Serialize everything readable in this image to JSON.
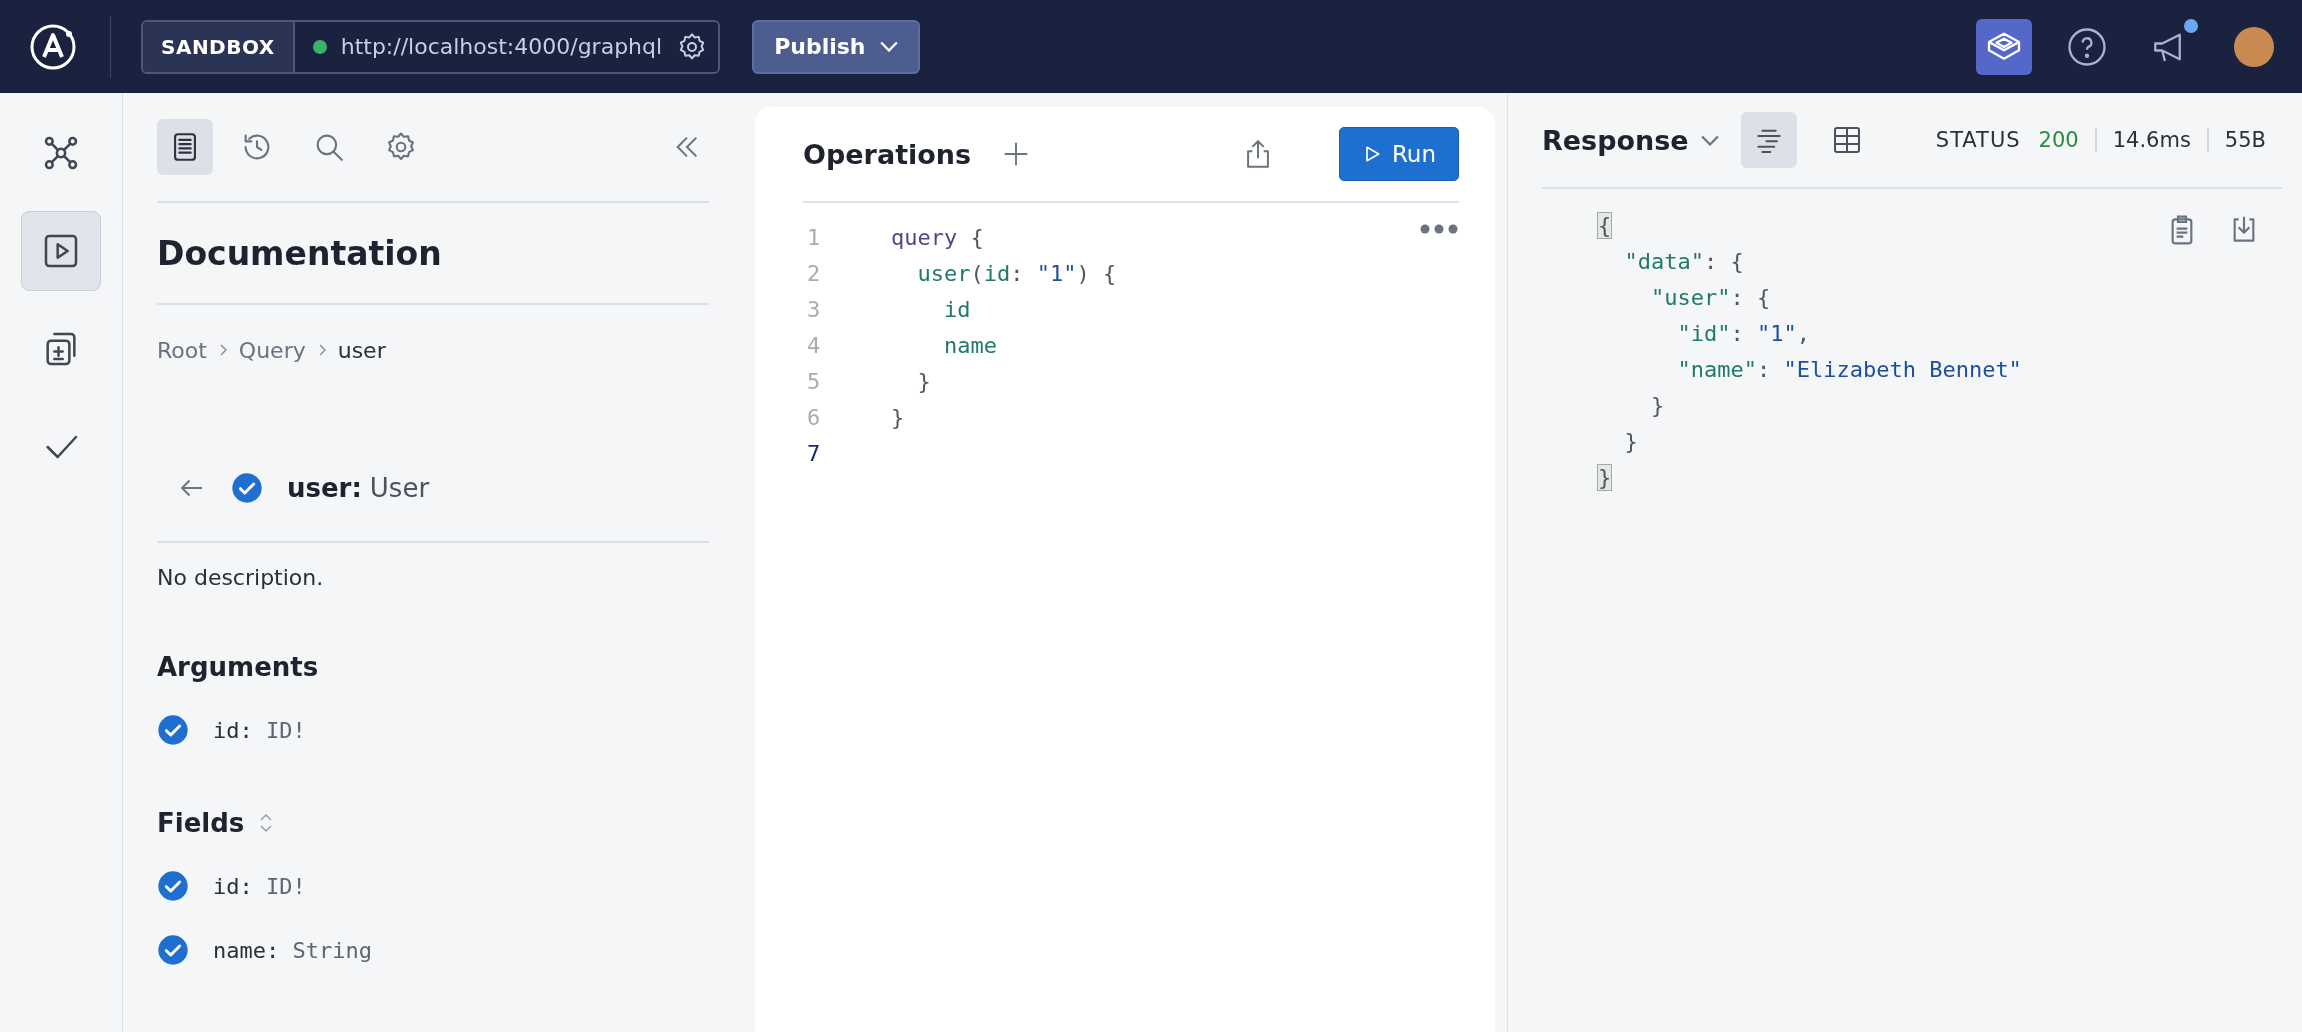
{
  "header": {
    "mode_label": "SANDBOX",
    "endpoint": "http://localhost:4000/graphql",
    "endpoint_connected": true,
    "publish_label": "Publish",
    "notification_unread": true
  },
  "rail": [
    {
      "selected": false
    },
    {
      "selected": true
    },
    {
      "selected": false
    },
    {
      "selected": false
    }
  ],
  "docs": {
    "tools": [
      {
        "selected": true
      },
      {
        "selected": false
      },
      {
        "selected": false
      },
      {
        "selected": false
      }
    ],
    "title": "Documentation",
    "breadcrumb": [
      {
        "label": "Root",
        "current": false
      },
      {
        "label": "Query",
        "current": false
      },
      {
        "label": "user",
        "current": true
      }
    ],
    "field": {
      "name": "user:",
      "type": "User",
      "included": true
    },
    "description": "No description.",
    "sections": [
      {
        "title": "Arguments",
        "sortable": false,
        "items": [
          {
            "name": "id:",
            "type": "ID!",
            "included": true
          }
        ]
      },
      {
        "title": "Fields",
        "sortable": true,
        "items": [
          {
            "name": "id:",
            "type": "ID!",
            "included": true
          },
          {
            "name": "name:",
            "type": "String",
            "included": true
          }
        ]
      }
    ]
  },
  "operations": {
    "title": "Operations",
    "run_label": "Run",
    "lines": [
      {
        "number": "1",
        "current": false,
        "tokens": [
          {
            "text": "query",
            "kind": "keyword"
          },
          {
            "text": " {",
            "kind": "punct"
          }
        ]
      },
      {
        "number": "2",
        "current": false,
        "tokens": [
          {
            "text": "  user",
            "kind": "field"
          },
          {
            "text": "(",
            "kind": "punct"
          },
          {
            "text": "id",
            "kind": "field"
          },
          {
            "text": ": ",
            "kind": "punct"
          },
          {
            "text": "\"1\"",
            "kind": "string"
          },
          {
            "text": ") {",
            "kind": "punct"
          }
        ]
      },
      {
        "number": "3",
        "current": false,
        "tokens": [
          {
            "text": "    id",
            "kind": "field"
          }
        ]
      },
      {
        "number": "4",
        "current": false,
        "tokens": [
          {
            "text": "    name",
            "kind": "field"
          }
        ]
      },
      {
        "number": "5",
        "current": false,
        "tokens": [
          {
            "text": "  }",
            "kind": "punct"
          }
        ]
      },
      {
        "number": "6",
        "current": false,
        "tokens": [
          {
            "text": "}",
            "kind": "punct"
          }
        ]
      },
      {
        "number": "7",
        "current": true
      }
    ]
  },
  "response": {
    "title": "Response",
    "views": [
      {
        "selected": true
      },
      {
        "selected": false
      }
    ],
    "status_label": "STATUS",
    "status_code": "200",
    "duration": "14.6ms",
    "size": "55B",
    "lines": [
      {
        "tokens": [
          {
            "text": "{",
            "kind": "bracket-match"
          }
        ]
      },
      {
        "tokens": [
          {
            "text": "  \"data\"",
            "kind": "property"
          },
          {
            "text": ": {",
            "kind": "punct"
          }
        ]
      },
      {
        "tokens": [
          {
            "text": "    \"user\"",
            "kind": "property"
          },
          {
            "text": ": {",
            "kind": "punct"
          }
        ]
      },
      {
        "tokens": [
          {
            "text": "      \"id\"",
            "kind": "property"
          },
          {
            "text": ": ",
            "kind": "punct"
          },
          {
            "text": "\"1\"",
            "kind": "string"
          },
          {
            "text": ",",
            "kind": "punct"
          }
        ]
      },
      {
        "tokens": [
          {
            "text": "      \"name\"",
            "kind": "property"
          },
          {
            "text": ": ",
            "kind": "punct"
          },
          {
            "text": "\"Elizabeth Bennet\"",
            "kind": "string"
          }
        ]
      },
      {
        "tokens": [
          {
            "text": "    }",
            "kind": "punct"
          }
        ]
      },
      {
        "tokens": [
          {
            "text": "  }",
            "kind": "punct"
          }
        ]
      },
      {
        "tokens": [
          {
            "text": "}",
            "kind": "bracket-match"
          }
        ]
      }
    ]
  }
}
